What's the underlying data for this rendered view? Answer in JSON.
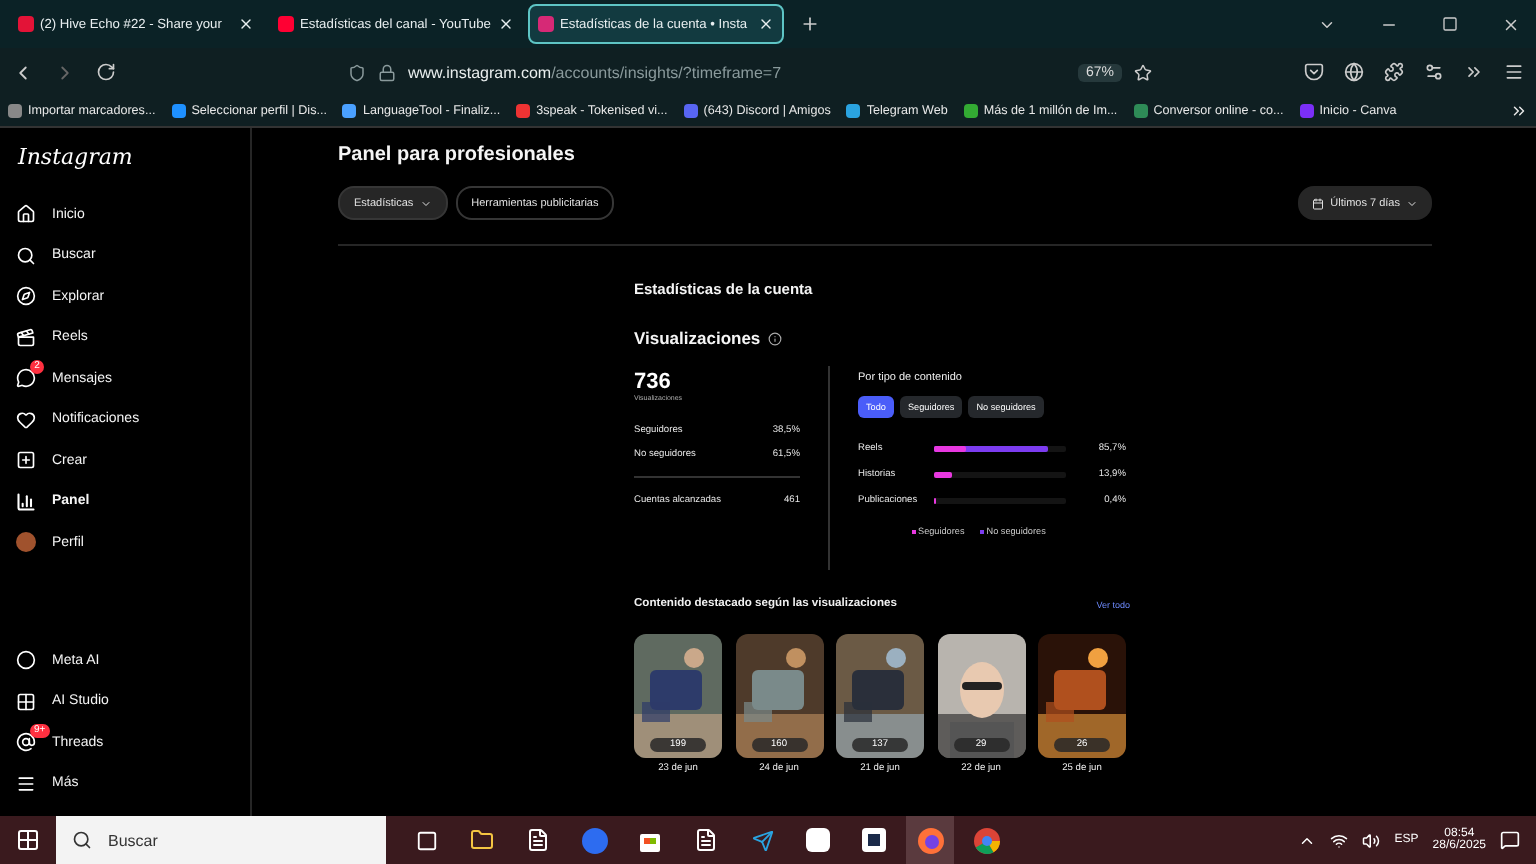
{
  "browser": {
    "tabs": [
      {
        "title": "(2) Hive Echo #22 - Share your",
        "selected": false
      },
      {
        "title": "Estadísticas del canal - YouTube",
        "selected": false
      },
      {
        "title": "Estadísticas de la cuenta • Insta",
        "selected": true
      }
    ],
    "url_host": "www.instagram.com",
    "url_path": "/accounts/insights/?timeframe=7",
    "zoom": "67%",
    "bookmarks": [
      "Importar marcadores...",
      "Seleccionar perfil | Dis...",
      "LanguageTool - Finaliz...",
      "3speak - Tokenised vi...",
      "(643) Discord | Amigos",
      "Telegram Web",
      "Más de 1 millón de Im...",
      "Conversor online - co...",
      "Inicio - Canva"
    ]
  },
  "sidebar": {
    "logo": "Instagram",
    "items": [
      {
        "label": "Inicio",
        "selected": false
      },
      {
        "label": "Buscar",
        "selected": false
      },
      {
        "label": "Explorar",
        "selected": false
      },
      {
        "label": "Reels",
        "selected": false
      },
      {
        "label": "Mensajes",
        "selected": false,
        "badge": "2"
      },
      {
        "label": "Notificaciones",
        "selected": false
      },
      {
        "label": "Crear",
        "selected": false
      },
      {
        "label": "Panel",
        "selected": true
      },
      {
        "label": "Perfil",
        "selected": false
      }
    ],
    "bottom_items": [
      {
        "label": "Meta AI"
      },
      {
        "label": "AI Studio"
      },
      {
        "label": "Threads",
        "badge": "9+"
      },
      {
        "label": "Más"
      }
    ]
  },
  "header": {
    "title": "Panel para profesionales",
    "filters": [
      {
        "label": "Estadísticas",
        "selected": true
      },
      {
        "label": "Herramientas publicitarias",
        "selected": false
      }
    ],
    "period": "Últimos 7 días"
  },
  "insights": {
    "title": "Estadísticas de la cuenta",
    "metric": "Visualizaciones",
    "total": "736",
    "total_label": "Visualizaciones",
    "split": [
      {
        "label": "Seguidores",
        "value": "38,5%"
      },
      {
        "label": "No seguidores",
        "value": "61,5%"
      }
    ],
    "reached": {
      "label": "Cuentas alcanzadas",
      "value": "461"
    },
    "by_type": {
      "title": "Por tipo de contenido",
      "filters": [
        {
          "label": "Todo",
          "selected": true
        },
        {
          "label": "Seguidores",
          "selected": false
        },
        {
          "label": "No seguidores",
          "selected": false
        }
      ],
      "rows": [
        {
          "label": "Reels",
          "value": "85,7%",
          "level": 0.857,
          "followers": {
            "level": 0.24
          }
        },
        {
          "label": "Historias",
          "value": "13,9%",
          "level": 0.139,
          "followers": {
            "level": 0.139
          }
        },
        {
          "label": "Publicaciones",
          "value": "0,4%",
          "level": 0.004,
          "followers": {
            "level": 0.004
          }
        }
      ],
      "legend": [
        {
          "label": "Seguidores",
          "color": "#e838e0"
        },
        {
          "label": "No seguidores",
          "color": "#7c3cf0"
        }
      ]
    }
  },
  "top_content": {
    "title": "Contenido destacado según las visualizaciones",
    "link": "Ver todo",
    "items": [
      {
        "views": "199",
        "date": "23 de jun"
      },
      {
        "views": "160",
        "date": "24 de jun"
      },
      {
        "views": "137",
        "date": "21 de jun"
      },
      {
        "views": "29",
        "date": "22 de jun"
      },
      {
        "views": "26",
        "date": "25 de jun"
      }
    ]
  },
  "taskbar": {
    "search": "Buscar",
    "lang": "ESP",
    "time": "08:54",
    "date": "28/6/2025"
  }
}
